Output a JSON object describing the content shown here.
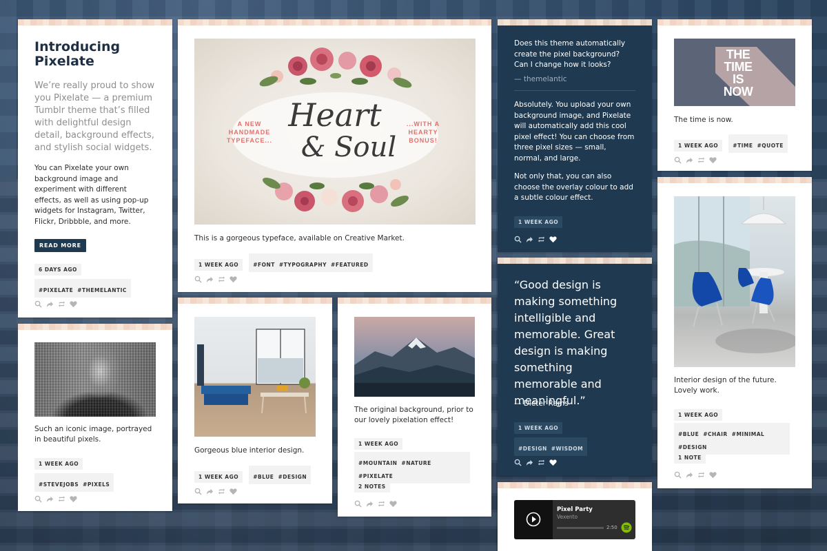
{
  "intro": {
    "title": "Introducing Pixelate",
    "lead": "We’re really proud to show you Pixelate — a premium Tumblr theme that’s filled with delightful design detail, background effects, and stylish social widgets.",
    "body": "You can Pixelate your own background image and experiment with different effects, as well as using pop-up widgets for Instagram, Twitter, Flickr, Dribbble, and more.",
    "read_more": "READ MORE",
    "date": "6 DAYS AGO",
    "tags": [
      "#PIXELATE",
      "#THEMELANTIC"
    ]
  },
  "heart_soul": {
    "left_text": [
      "A NEW",
      "HANDMADE",
      "TYPEFACE..."
    ],
    "right_text": [
      "...WITH A",
      "HEARTY",
      "BONUS!"
    ],
    "script_line1": "Heart",
    "script_line2": "& Soul",
    "caption_prefix": "This is a gorgeous typeface, available on",
    "caption_link": "Creative Market.",
    "date": "1 WEEK AGO",
    "tags": [
      "#FONT",
      "#TYPOGRAPHY",
      "#FEATURED"
    ]
  },
  "faq": {
    "question": "Does this theme automatically create the pixel background? Can I change how it looks?",
    "asker": "— themelantic",
    "answer1": "Absolutely. You upload your own background image, and Pixelate will automatically add this cool pixel effect! You can choose from three pixel sizes — small, normal, and large.",
    "answer2": "Not only that, you can also choose the overlay colour to add a subtle colour effect.",
    "date": "1 WEEK AGO"
  },
  "time_post": {
    "image_text": [
      "THE",
      "TIME",
      "IS",
      "NOW"
    ],
    "caption": "The time is now.",
    "date": "1 WEEK AGO",
    "tags": [
      "#TIME",
      "#QUOTE"
    ]
  },
  "jobs": {
    "caption": "Such an iconic image, portrayed in beautiful pixels.",
    "date": "1 WEEK AGO",
    "tags": [
      "#STEVEJOBS",
      "#PIXELS"
    ]
  },
  "interior1": {
    "caption": "Gorgeous blue interior design.",
    "date": "1 WEEK AGO",
    "tags": [
      "#BLUE",
      "#DESIGN"
    ]
  },
  "mountain": {
    "caption": "The original background, prior to our lovely pixelation effect!",
    "date": "1 WEEK AGO",
    "tags": [
      "#MOUNTAIN",
      "#NATURE",
      "#PIXELATE"
    ],
    "notes": "2 NOTES"
  },
  "quote": {
    "text": "“Good design is making something intelligible and memorable. Great design is making something memorable and meaningful.”",
    "source": "— Dieter Rams",
    "date": "1 WEEK AGO",
    "tags": [
      "#DESIGN",
      "#WISDOM"
    ]
  },
  "interior2": {
    "caption": "Interior design of the future. Lovely work.",
    "date": "1 WEEK AGO",
    "tags": [
      "#BLUE",
      "#CHAIR",
      "#MINIMAL",
      "#DESIGN"
    ],
    "notes": "1 NOTE"
  },
  "audio": {
    "track": "Pixel Party",
    "artist": "Vexento",
    "time": "2:50"
  },
  "colors": {
    "navy": "#1f3a50",
    "accent_pink": "#e0706c"
  }
}
